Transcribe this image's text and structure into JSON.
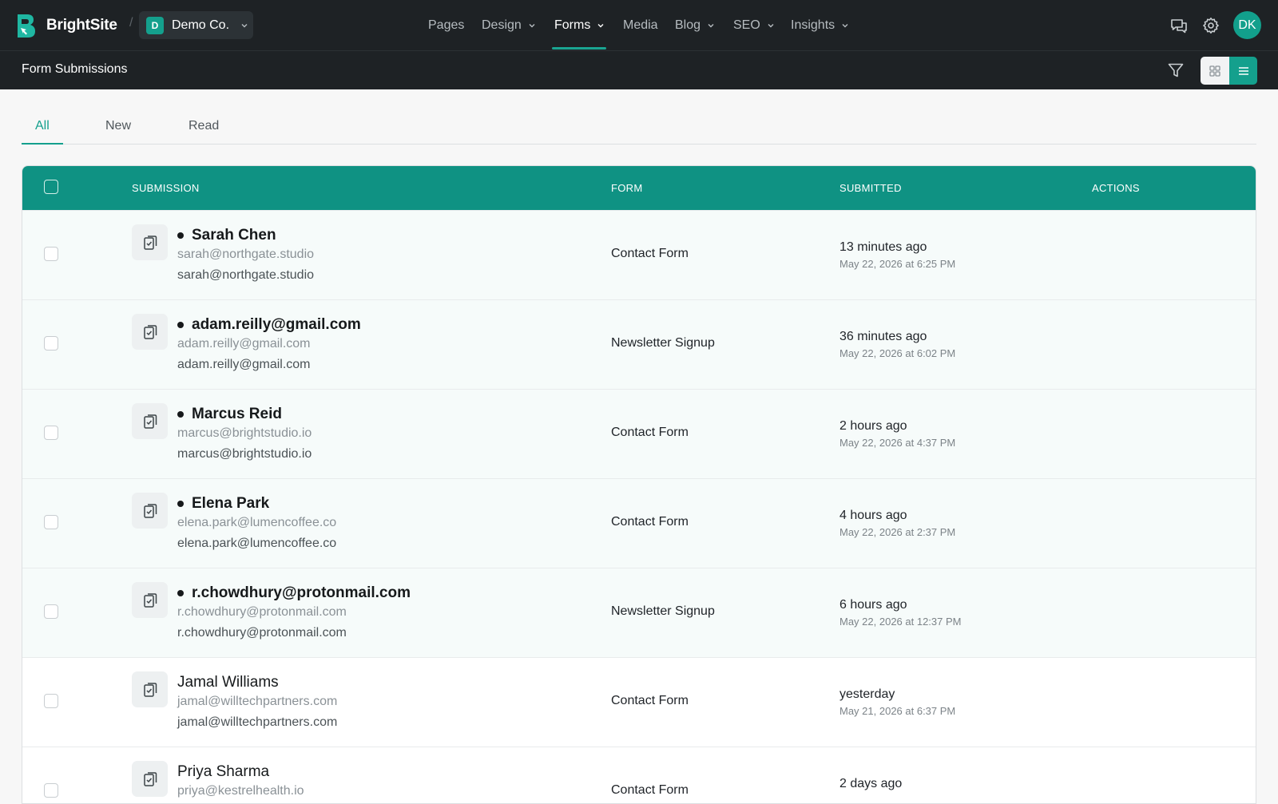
{
  "app": {
    "name": "BrightSite",
    "workspace": {
      "initial": "D",
      "name": "Demo Co."
    },
    "user_initials": "DK"
  },
  "nav": [
    {
      "label": "Pages",
      "dropdown": false,
      "active": false
    },
    {
      "label": "Design",
      "dropdown": true,
      "active": false
    },
    {
      "label": "Forms",
      "dropdown": true,
      "active": true
    },
    {
      "label": "Media",
      "dropdown": false,
      "active": false
    },
    {
      "label": "Blog",
      "dropdown": true,
      "active": false
    },
    {
      "label": "SEO",
      "dropdown": true,
      "active": false
    },
    {
      "label": "Insights",
      "dropdown": true,
      "active": false
    }
  ],
  "top_icons": [
    "chat-icon",
    "gear-icon"
  ],
  "page": {
    "title": "Form Submissions"
  },
  "tabs": [
    {
      "label": "All",
      "active": true
    },
    {
      "label": "New",
      "active": false
    },
    {
      "label": "Read",
      "active": false
    }
  ],
  "table": {
    "headers": {
      "submission": "SUBMISSION",
      "form": "FORM",
      "submitted": "SUBMITTED",
      "actions": "ACTIONS"
    },
    "rows": [
      {
        "name": "Sarah Chen",
        "email": "sarah@northgate.studio",
        "email2": "sarah@northgate.studio",
        "form": "Contact Form",
        "relative": "13 minutes ago",
        "date": "May 22, 2026 at 6:25 PM",
        "unread": true
      },
      {
        "name": "adam.reilly@gmail.com",
        "email": "adam.reilly@gmail.com",
        "email2": "adam.reilly@gmail.com",
        "form": "Newsletter Signup",
        "relative": "36 minutes ago",
        "date": "May 22, 2026 at 6:02 PM",
        "unread": true
      },
      {
        "name": "Marcus Reid",
        "email": "marcus@brightstudio.io",
        "email2": "marcus@brightstudio.io",
        "form": "Contact Form",
        "relative": "2 hours ago",
        "date": "May 22, 2026 at 4:37 PM",
        "unread": true
      },
      {
        "name": "Elena Park",
        "email": "elena.park@lumencoffee.co",
        "email2": "elena.park@lumencoffee.co",
        "form": "Contact Form",
        "relative": "4 hours ago",
        "date": "May 22, 2026 at 2:37 PM",
        "unread": true
      },
      {
        "name": "r.chowdhury@protonmail.com",
        "email": "r.chowdhury@protonmail.com",
        "email2": "r.chowdhury@protonmail.com",
        "form": "Newsletter Signup",
        "relative": "6 hours ago",
        "date": "May 22, 2026 at 12:37 PM",
        "unread": true
      },
      {
        "name": "Jamal Williams",
        "email": "jamal@willtechpartners.com",
        "email2": "jamal@willtechpartners.com",
        "form": "Contact Form",
        "relative": "yesterday",
        "date": "May 21, 2026 at 6:37 PM",
        "unread": false
      },
      {
        "name": "Priya Sharma",
        "email": "priya@kestrelhealth.io",
        "email2": "",
        "form": "Contact Form",
        "relative": "2 days ago",
        "date": "",
        "unread": false
      }
    ]
  },
  "colors": {
    "accent": "#14a08d",
    "header_bg": "#0f9283",
    "topbar_bg": "#1e2225"
  }
}
